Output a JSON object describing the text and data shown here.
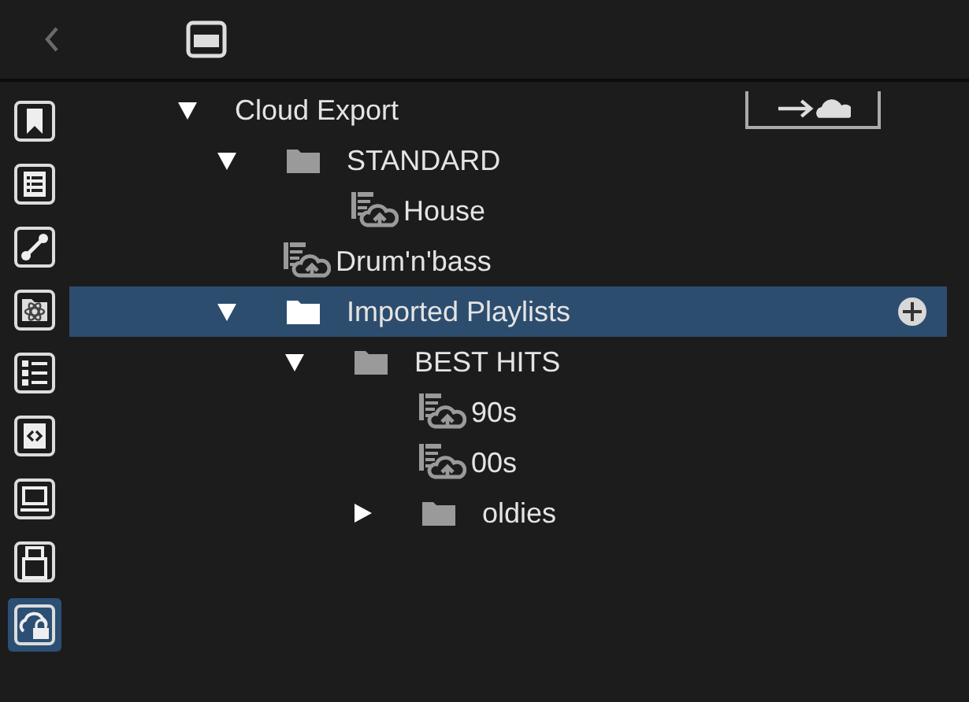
{
  "sidebar": {
    "items": [
      {
        "selected": false
      },
      {
        "selected": false
      },
      {
        "selected": false
      },
      {
        "selected": false
      },
      {
        "selected": false
      },
      {
        "selected": false
      },
      {
        "selected": false
      },
      {
        "selected": false
      },
      {
        "selected": true
      }
    ]
  },
  "tree": {
    "label": "Cloud Export",
    "kind": "root",
    "expanded": true,
    "selected": false,
    "children": [
      {
        "label": "STANDARD",
        "kind": "folder",
        "expanded": true,
        "selected": false,
        "children": [
          {
            "label": "House",
            "kind": "playlist",
            "selected": false
          }
        ]
      },
      {
        "label": "Drum'n'bass",
        "kind": "playlist",
        "selected": false
      },
      {
        "label": "Imported Playlists",
        "kind": "folder",
        "expanded": true,
        "selected": true,
        "children": [
          {
            "label": "BEST HITS",
            "kind": "folder",
            "expanded": true,
            "selected": false,
            "children": [
              {
                "label": "90s",
                "kind": "playlist",
                "selected": false
              },
              {
                "label": "00s",
                "kind": "playlist",
                "selected": false
              },
              {
                "label": "oldies",
                "kind": "folder",
                "expanded": false,
                "selected": false
              }
            ]
          }
        ]
      }
    ]
  }
}
